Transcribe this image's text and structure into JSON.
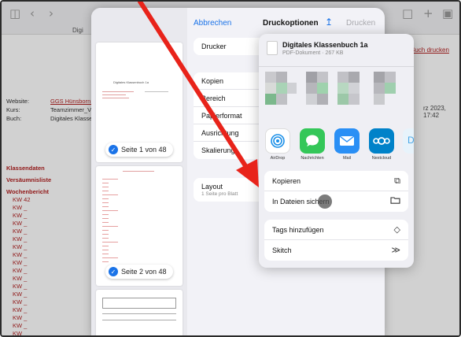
{
  "background": {
    "tab_label": "Digi",
    "website_label": "Website:",
    "website_value": "GGS Hünsborn Lo",
    "kurs_label": "Kurs:",
    "kurs_value": "Teamzimmer_Vor",
    "buch_label": "Buch:",
    "buch_value": "Digitales Klassenl",
    "buch_drucken": "Buch drucken",
    "date_fragment": "rz 2023, 17:42",
    "nav_items": [
      "Klassendaten",
      "Versäumnisliste",
      "Wochenbericht"
    ],
    "kw_items": [
      "KW 42",
      "KW _",
      "KW _",
      "KW _",
      "KW _",
      "KW _",
      "KW _",
      "KW _",
      "KW _",
      "KW _",
      "KW _",
      "KW _",
      "KW _",
      "KW _",
      "KW _",
      "KW _",
      "KW _",
      "KW _",
      "KW _"
    ],
    "kw_last": "KW"
  },
  "print_options": {
    "cancel_label": "Abbrechen",
    "title": "Druckoptionen",
    "print_label": "Drucken",
    "rows": {
      "drucker": "Drucker",
      "kopien": "Kopien",
      "bereich": "Bereich",
      "papierformat": "Papierformat",
      "ausrichtung": "Ausrichtung",
      "skalierung": "Skalierung",
      "layout": "Layout",
      "layout_sub": "1 Seite pro Blatt"
    },
    "thumb1_title": "Digitales Klassenbuch 1a",
    "page1_badge": "Seite 1 von 48",
    "page2_badge": "Seite 2 von 48"
  },
  "share_sheet": {
    "doc_title": "Digitales Klassenbuch 1a",
    "doc_subtitle": "PDF-Dokument · 267 KB",
    "apps": [
      {
        "label": "AirDrop",
        "icon": "airdrop-icon"
      },
      {
        "label": "Nachrichten",
        "icon": "messages-icon"
      },
      {
        "label": "Mail",
        "icon": "mail-icon"
      },
      {
        "label": "Nextcloud",
        "icon": "nextcloud-icon"
      }
    ],
    "actions_1": [
      {
        "label": "Kopieren",
        "icon": "copy-icon"
      },
      {
        "label": "In Dateien sichern",
        "icon": "folder-icon"
      }
    ],
    "actions_2": [
      {
        "label": "Tags hinzufügen",
        "icon": "tag-icon"
      },
      {
        "label": "Skitch",
        "icon": "skitch-icon"
      }
    ]
  },
  "colors": {
    "accent": "#1a73e8",
    "annotation_arrow": "#e8231a",
    "link_red": "#b22222"
  }
}
